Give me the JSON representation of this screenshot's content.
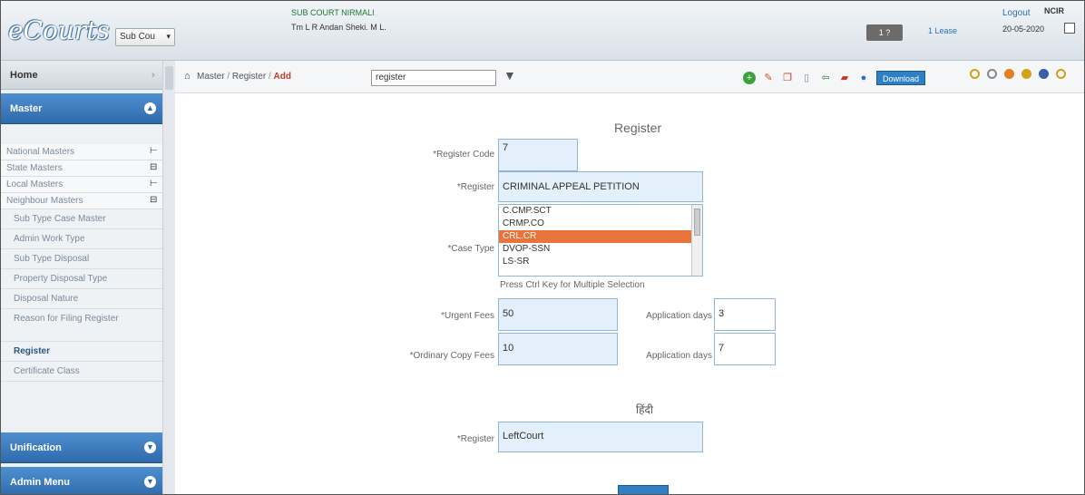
{
  "header": {
    "logo": "eCourts",
    "court_select": "Sub Cou",
    "court_name": "SUB COURT NIRMALI",
    "court_subtitle": "Tm L R Andan Sheki. M L.",
    "user_button": "1 ?",
    "user_link": "1 Lease",
    "logout": "Logout",
    "logout_badge": "NCIR",
    "date": "20-05-2020"
  },
  "toolbar": {
    "breadcrumb": {
      "root": "Master",
      "mid": "Register",
      "active": "Add"
    },
    "search_value": "register",
    "download_label": "Download"
  },
  "sidebar": {
    "home": "Home",
    "master": "Master",
    "items": [
      "National Masters",
      "State Masters",
      "Local Masters",
      "Neighbour Masters",
      "Sub Type Case Master",
      "Admin Work Type",
      "Sub Type Disposal",
      "Property Disposal Type",
      "Disposal Nature",
      "Reason for Filing Register",
      "Register",
      "Certificate Class"
    ],
    "unification": "Unification",
    "admin_menu": "Admin Menu"
  },
  "form": {
    "title": "Register",
    "register_code_label": "*Register Code",
    "register_code_value": "7",
    "register_label": "*Register",
    "register_value": "CRIMINAL APPEAL PETITION",
    "case_type_label": "*Case Type",
    "case_type_options": [
      "C.CMP.SCT",
      "CRMP.CO",
      "CRL.CR",
      "DVOP-SSN",
      "LS-SR"
    ],
    "case_type_selected": "CRL.CR",
    "hint": "Press Ctrl Key for Multiple Selection",
    "urgent_fees_label": "*Urgent Fees",
    "urgent_fees_value": "50",
    "ordinary_fees_label": "*Ordinary Copy Fees",
    "ordinary_fees_value": "10",
    "appl_days_1_label": "Application days",
    "appl_days_1_value": "3",
    "appl_days_2_label": "Application days",
    "appl_days_2_value": "7",
    "regional_title": "हिंदी",
    "regional_label": "*Register",
    "regional_value": "LeftCourt"
  },
  "colors": {
    "accent": "#2e6aab",
    "selected": "#e8743b",
    "field_bg": "#e3f0fb"
  }
}
